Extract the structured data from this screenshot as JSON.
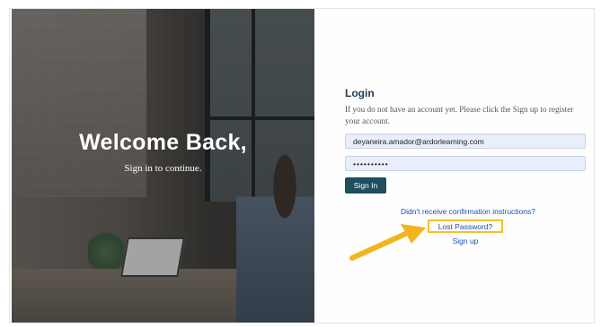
{
  "hero": {
    "title": "Welcome Back,",
    "subtitle": "Sign in to continue."
  },
  "login": {
    "title": "Login",
    "description": "If you do not have an account yet. Please click the Sign up to register your account.",
    "email_value": "deyaneira.amador@ardorlearning.com",
    "password_value": "••••••••••",
    "signin_label": "Sign In",
    "confirm_link": "Didn't receive confirmation instructions?",
    "lost_password_link": "Lost Password?",
    "signup_link": "Sign up"
  },
  "annotation": {
    "arrow_color": "#f2b51d",
    "highlight_color": "#f2c12e"
  },
  "colors": {
    "signin_button": "#1f4e5f",
    "link": "#1a4fb8",
    "title": "#1e3a57"
  }
}
